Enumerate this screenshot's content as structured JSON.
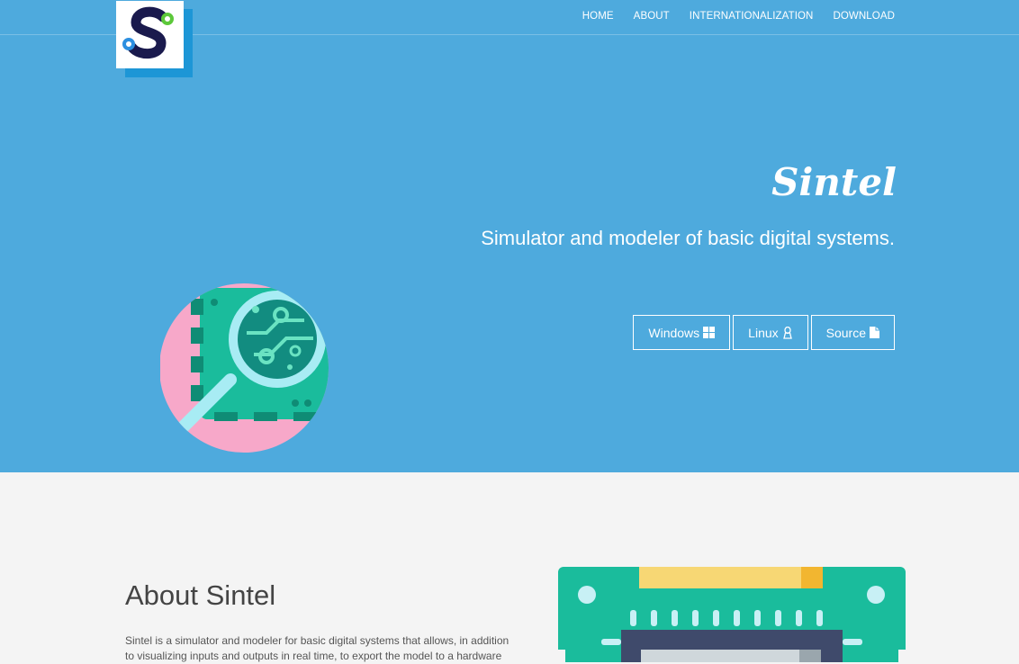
{
  "nav": {
    "home": "HOME",
    "about": "ABOUT",
    "internationalization": "INTERNATIONALIZATION",
    "download": "DOWNLOAD"
  },
  "hero": {
    "brand": "Sintel",
    "tagline": "Simulator and modeler of basic digital systems.",
    "buttons": {
      "windows": "Windows",
      "linux": "Linux",
      "source": "Source"
    }
  },
  "about": {
    "title": "About Sintel",
    "text": "Sintel is a simulator and modeler for basic digital systems that allows, in addition to visualizing inputs and outputs in real time, to export the model to a hardware"
  },
  "colors": {
    "hero_bg": "#4eaadd",
    "page_bg": "#f4f4f4",
    "circuit_green": "#1abc9c",
    "accent_pink": "#f7a8c9"
  }
}
